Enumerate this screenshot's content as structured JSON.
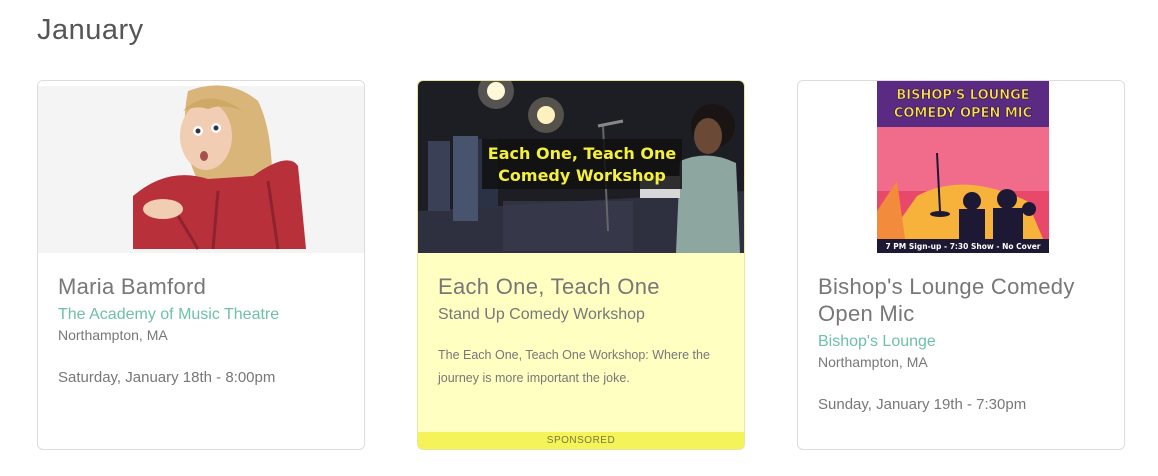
{
  "page": {
    "month_heading": "January"
  },
  "cards": [
    {
      "title": "Maria Bamford",
      "venue": "The Academy of Music Theatre",
      "city": "Northampton, MA",
      "date": "Saturday, January 18th - 8:00pm"
    },
    {
      "title": "Each One, Teach One",
      "subtitle": "Stand Up Comedy Workshop",
      "description": "The Each One, Teach One Workshop: Where the journey is more important the joke.",
      "image_caption_line1": "Each One, Teach One",
      "image_caption_line2": "Comedy Workshop",
      "badge": "SPONSORED"
    },
    {
      "title": "Bishop's Lounge Comedy Open Mic",
      "venue": "Bishop's Lounge",
      "city": "Northampton, MA",
      "date": "Sunday, January 19th - 7:30pm",
      "poster_line1": "BISHOP'S LOUNGE",
      "poster_line2": "COMEDY OPEN MIC",
      "poster_footer": "7 PM Sign-up - 7:30 Show - No Cover"
    }
  ],
  "colors": {
    "venue_link": "#6fc1a6",
    "sponsored_bg": "#ffffc2",
    "sponsored_badge": "#f4f45a"
  }
}
